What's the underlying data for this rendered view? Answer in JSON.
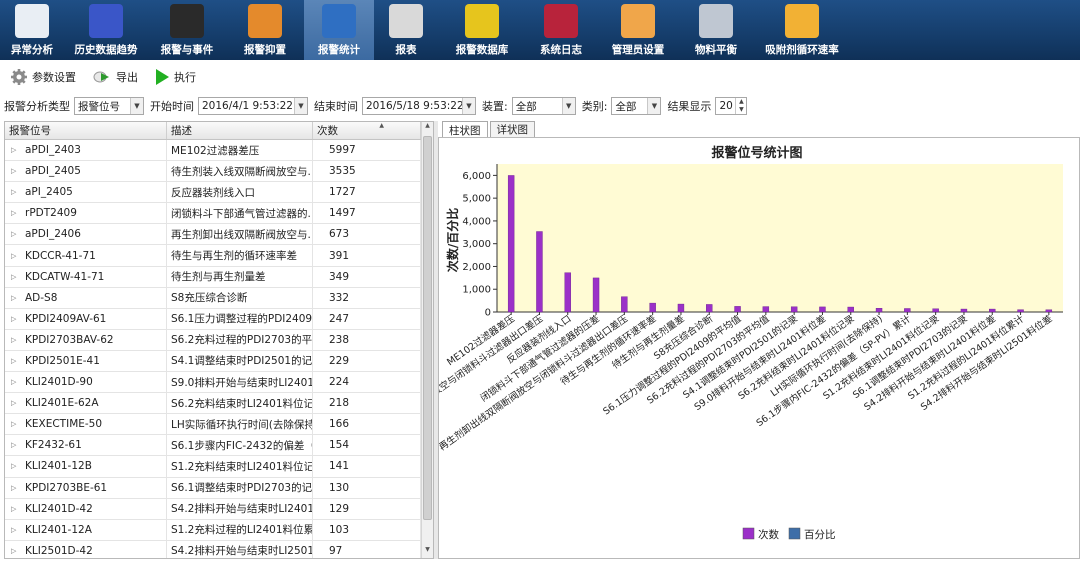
{
  "nav": {
    "items": [
      {
        "label": "异常分析",
        "icon": "gauge-icon",
        "color": "#e9eef4",
        "active": false,
        "w": 64
      },
      {
        "label": "历史数据趋势",
        "icon": "trend-chart-icon",
        "color": "#3a56c8",
        "active": false,
        "w": 84
      },
      {
        "label": "报警与事件",
        "icon": "alarm-panel-icon",
        "color": "#2a2a2a",
        "active": false,
        "w": 78
      },
      {
        "label": "报警抑置",
        "icon": "alarm-clock-icon",
        "color": "#e48a2c",
        "active": false,
        "w": 78
      },
      {
        "label": "报警统计",
        "icon": "tools-icon",
        "color": "#2f6fc2",
        "active": true,
        "w": 70
      },
      {
        "label": "报表",
        "icon": "report-chart-icon",
        "color": "#d9d9d9",
        "active": false,
        "w": 64
      },
      {
        "label": "报警数据库",
        "icon": "database-icon",
        "color": "#e6c51d",
        "active": false,
        "w": 88
      },
      {
        "label": "系统日志",
        "icon": "log-icon",
        "color": "#b8233b",
        "active": false,
        "w": 70
      },
      {
        "label": "管理员设置",
        "icon": "warning-settings-icon",
        "color": "#f0a64a",
        "active": false,
        "w": 84
      },
      {
        "label": "物料平衡",
        "icon": "gear-icon",
        "color": "#bfc7d2",
        "active": false,
        "w": 72
      },
      {
        "label": "吸附剂循环速率",
        "icon": "cycle-arrows-icon",
        "color": "#f2b134",
        "active": false,
        "w": 100
      }
    ]
  },
  "toolbar": {
    "params_label": "参数设置",
    "export_label": "导出",
    "run_label": "执行"
  },
  "filter": {
    "type_label": "报警分析类型",
    "type_value": "报警位号",
    "start_label": "开始时间",
    "start_value": "2016/4/1 9:53:22",
    "end_label": "结束时间",
    "end_value": "2016/5/18 9:53:22",
    "device_label": "装置:",
    "device_value": "全部",
    "category_label": "类别:",
    "category_value": "全部",
    "display_label": "结果显示",
    "display_value": "20"
  },
  "table": {
    "headers": [
      "报警位号",
      "描述",
      "次数"
    ],
    "rows": [
      [
        "aPDI_2403",
        "ME102过滤器差压",
        "5997"
      ],
      [
        "aPDI_2405",
        "待生剂装入线双隔断阀放空与...",
        "3535"
      ],
      [
        "aPI_2405",
        "反应器装剂线入口",
        "1727"
      ],
      [
        "rPDT2409",
        "闭锁料斗下部通气管过滤器的...",
        "1497"
      ],
      [
        "aPDI_2406",
        "再生剂卸出线双隔断阀放空与...",
        "673"
      ],
      [
        "KDCCR-41-71",
        "待生与再生剂的循环速率差",
        "391"
      ],
      [
        "KDCATW-41-71",
        "待生剂与再生剂量差",
        "349"
      ],
      [
        "AD-S8",
        "S8充压综合诊断",
        "332"
      ],
      [
        "KPDI2409AV-61",
        "S6.1压力调整过程的PDI2409...",
        "247"
      ],
      [
        "KPDI2703BAV-62",
        "S6.2充料过程的PDI2703的平...",
        "238"
      ],
      [
        "KPDI2501E-41",
        "S4.1调整结束时PDI2501的记录",
        "229"
      ],
      [
        "KLI2401D-90",
        "S9.0排料开始与结束时LI2401...",
        "224"
      ],
      [
        "KLI2401E-62A",
        "S6.2充料结束时LI2401料位记录",
        "218"
      ],
      [
        "KEXECTIME-50",
        "LH实际循环执行时间(去除保持)",
        "166"
      ],
      [
        "KF2432-61",
        "S6.1步骤内FIC-2432的偏差（...",
        "154"
      ],
      [
        "KLI2401-12B",
        "S1.2充料结束时LI2401料位记录",
        "141"
      ],
      [
        "KPDI2703BE-61",
        "S6.1调整结束时PDI2703的记录",
        "130"
      ],
      [
        "KLI2401D-42",
        "S4.2排料开始与结束时LI2401...",
        "129"
      ],
      [
        "KLI2401-12A",
        "S1.2充料过程的LI2401料位累计",
        "103"
      ],
      [
        "KLI2501D-42",
        "S4.2排料开始与结束时LI2501...",
        "97"
      ]
    ]
  },
  "tabs": [
    "柱状图",
    "详状图"
  ],
  "chart_data": {
    "type": "bar",
    "title": "报警位号统计图",
    "ylabel": "次数/百分比",
    "xlabel": "",
    "ylim": [
      0,
      6500
    ],
    "yticks": [
      "0",
      "1,000",
      "2,000",
      "3,000",
      "4,000",
      "5,000",
      "6,000"
    ],
    "categories": [
      "ME102过滤器差压",
      "待生剂装入线双隔断阀放空与闭锁料斗过滤器出口差压",
      "反应器装剂线入口",
      "闭锁料斗下部通气管过滤器的压差",
      "再生剂卸出线双隔断阀放空与闭锁料斗过滤器出口差压",
      "待生与再生剂的循环速率差",
      "待生剂与再生剂量差",
      "S8充压综合诊断",
      "S6.1压力调整过程的PDI2409的平均值",
      "S6.2充料过程的PDI2703的平均值",
      "S4.1调整结束时PDI2501的记录",
      "S9.0排料开始与结束时LI2401料位差",
      "S6.2充料结束时LI2401料位记录",
      "LH实际循环执行时间(去除保持)",
      "S6.1步骤内FIC-2432的偏差（SP-PV）累计",
      "S1.2充料结束时LI2401料位记录",
      "S6.1调整结束时PDI2703的记录",
      "S4.2排料开始与结束时LI2401料位差",
      "S1.2充料过程的LI2401料位累计",
      "S4.2排料开始与结束时LI2501料位差"
    ],
    "series": [
      {
        "name": "次数",
        "values": [
          5997,
          3535,
          1727,
          1497,
          673,
          391,
          349,
          332,
          247,
          238,
          229,
          224,
          218,
          166,
          154,
          141,
          130,
          129,
          103,
          97
        ],
        "color": "#9b30c8"
      },
      {
        "name": "百分比",
        "values": [],
        "color": "#3e6ea8"
      }
    ],
    "legend": "bottom",
    "plot_bg": "#fffbd4"
  }
}
